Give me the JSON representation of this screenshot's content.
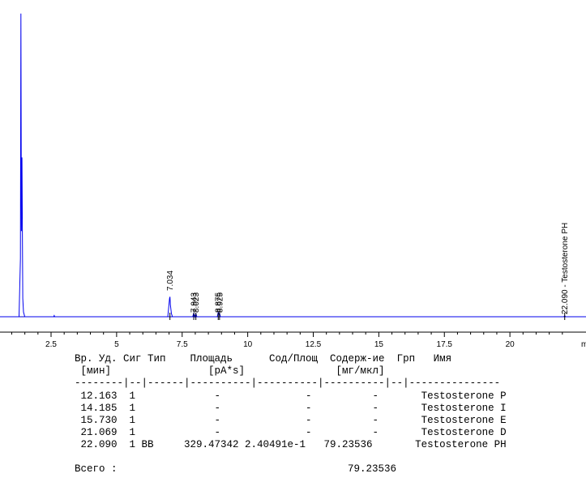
{
  "chart_data": {
    "type": "line",
    "x_unit": "мин",
    "xlim": [
      0.5,
      22.9
    ],
    "ylim": [
      0,
      1.0
    ],
    "x_ticks": [
      2.5,
      5,
      7.5,
      10,
      12.5,
      15,
      17.5,
      20
    ],
    "x_tick_labels": [
      "2.5",
      "5",
      "7.5",
      "10",
      "12.5",
      "15",
      "17.5",
      "20"
    ],
    "x_axis_end_label": "m",
    "series": [
      {
        "values_note": "",
        "x": [
          0.5,
          1.28,
          1.33,
          1.35,
          1.37,
          1.39,
          1.42,
          1.45,
          1.5,
          2.6,
          2.62,
          2.64,
          6.95,
          6.99,
          7.02,
          7.034,
          7.05,
          7.09,
          7.13,
          7.9,
          7.943,
          7.98,
          8.023,
          8.06,
          8.84,
          8.875,
          8.905,
          8.925,
          8.96,
          22.05,
          22.09,
          22.13,
          22.9
        ],
        "y": [
          0.0,
          0.0,
          0.19,
          0.99,
          0.28,
          0.52,
          0.06,
          0.015,
          0.0,
          0.0,
          0.004,
          0.0,
          0.0,
          0.035,
          0.06,
          0.065,
          0.04,
          0.01,
          0.0,
          0.0,
          0.012,
          0.0,
          0.01,
          0.0,
          0.0,
          0.014,
          0.008,
          0.012,
          0.0,
          0.0,
          0.003,
          0.0,
          0.0
        ]
      }
    ],
    "peak_labels": [
      {
        "x": 7.034,
        "text": "7.034"
      },
      {
        "x": 7.943,
        "text": "7.943"
      },
      {
        "x": 8.023,
        "text": "8.023"
      },
      {
        "x": 8.875,
        "text": "8.875"
      },
      {
        "x": 8.925,
        "text": "8.925"
      },
      {
        "x": 22.09,
        "text": "22.090 - Testosterone PH"
      }
    ]
  },
  "report": {
    "header_line1": "Вр. Уд. Сиг Тип    Площадь      Сод/Площ  Содерж-ие  Грп   Имя",
    "header_line2": " [мин]                [pA*s]               [мг/мкл]",
    "separator": "--------|--|------|----------|----------|----------|--|---------------",
    "rows": [
      " 12.163  1             -              -          -       Testosterone P",
      " 14.185  1             -              -          -       Testosterone I",
      " 15.730  1             -              -          -       Testosterone E",
      " 21.069  1             -              -          -       Testosterone D",
      " 22.090  1 BB     329.47342 2.40491e-1   79.23536       Testosterone PH"
    ],
    "total_label": "Всего :",
    "total_value": "79.23536"
  }
}
